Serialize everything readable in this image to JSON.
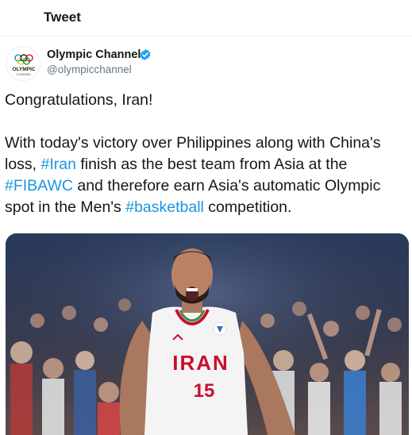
{
  "header": {
    "title": "Tweet"
  },
  "author": {
    "display_name": "Olympic Channel",
    "handle": "@olympicchannel",
    "avatar_text": "OLYMPIC",
    "avatar_subtext": "CHANNEL",
    "verified": true
  },
  "tweet": {
    "line1": "Congratulations, Iran!",
    "p2_a": "With today's victory over Philippines along with China's",
    "p2_b": "loss, ",
    "hashtag_iran": "#Iran",
    "p2_c": " finish as the best team from Asia at the",
    "hashtag_fibawc": "#FIBAWC",
    "p2_d": " and therefore earn Asia's automatic Olympic",
    "p2_e": "spot in the Men's ",
    "hashtag_basketball": "#basketball",
    "p2_f": " competition."
  },
  "media": {
    "jersey_text": "IRAN",
    "jersey_number": "15"
  },
  "colors": {
    "hashtag": "#1b95e0",
    "verified": "#1da1f2",
    "jersey_red": "#c8102e"
  },
  "icons": [
    "olympic-rings-icon",
    "verified-badge-icon"
  ]
}
